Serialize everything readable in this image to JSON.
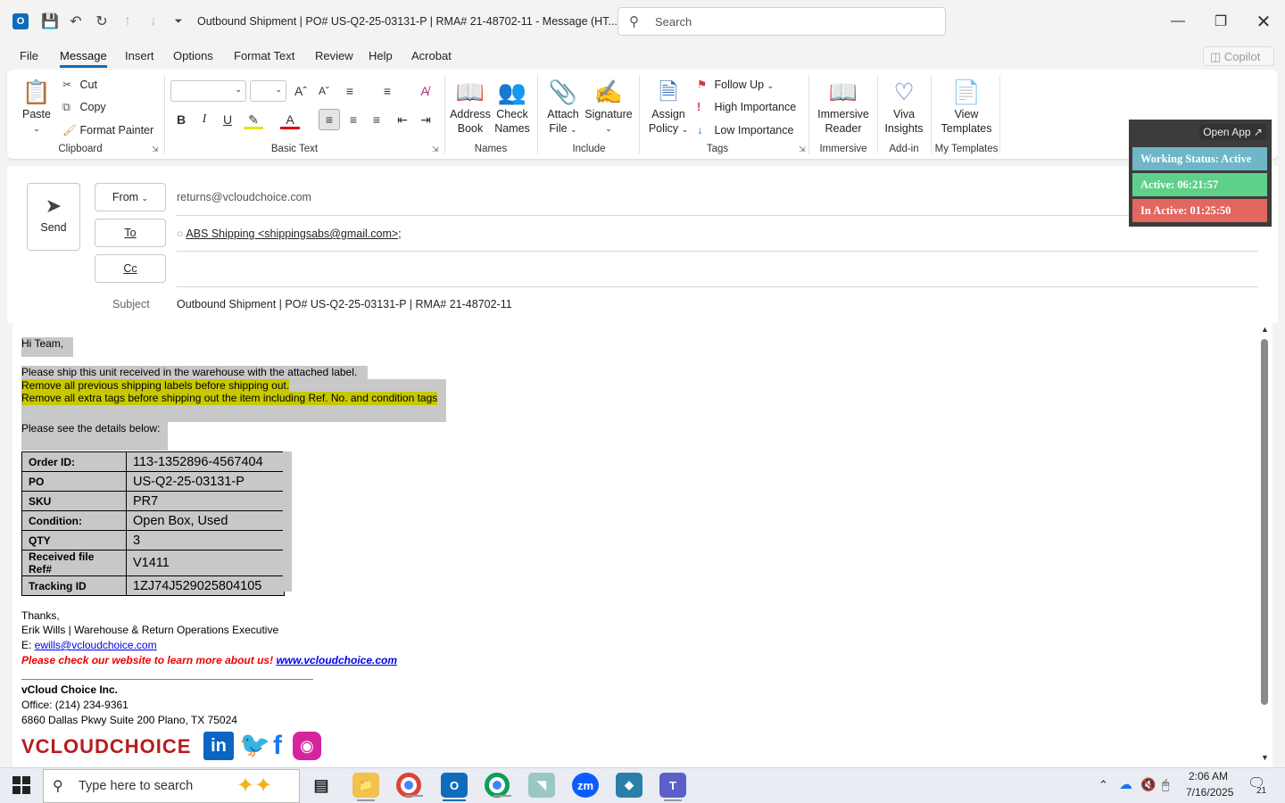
{
  "window": {
    "title": "Outbound Shipment | PO# US-Q2-25-03131-P | RMA# 21-48702-11  -  Message (HT...",
    "search_placeholder": "Search"
  },
  "menu": {
    "tabs": [
      "File",
      "Message",
      "Insert",
      "Options",
      "Format Text",
      "Review",
      "Help",
      "Acrobat"
    ],
    "copilot": "Copilot"
  },
  "ribbon": {
    "clipboard": {
      "paste": "Paste",
      "cut": "Cut",
      "copy": "Copy",
      "format_painter": "Format Painter",
      "label": "Clipboard"
    },
    "basic_text": {
      "label": "Basic Text"
    },
    "names": {
      "address_book_1": "Address",
      "address_book_2": "Book",
      "check_names_1": "Check",
      "check_names_2": "Names",
      "label": "Names"
    },
    "include": {
      "attach_1": "Attach",
      "attach_2": "File",
      "signature": "Signature",
      "label": "Include"
    },
    "tags": {
      "assign_1": "Assign",
      "assign_2": "Policy",
      "follow_up": "Follow Up",
      "high": "High Importance",
      "low": "Low Importance",
      "label": "Tags"
    },
    "immersive": {
      "btn_1": "Immersive",
      "btn_2": "Reader",
      "label": "Immersive"
    },
    "addin": {
      "btn_1": "Viva",
      "btn_2": "Insights",
      "label": "Add-in"
    },
    "templates": {
      "btn_1": "View",
      "btn_2": "Templates",
      "label": "My Templates"
    }
  },
  "compose": {
    "send_label": "Send",
    "from_label": "From",
    "from_value": "returns@vcloudchoice.com",
    "to_label": "To",
    "to_value": "ABS Shipping <shippingsabs@gmail.com>;",
    "cc_label": "Cc",
    "subject_label": "Subject",
    "subject_value": "Outbound Shipment | PO# US-Q2-25-03131-P | RMA# 21-48702-11"
  },
  "status_widget": {
    "open_app": "Open App ↗",
    "working": "Working Status: Active",
    "active": "Active: 06:21:57",
    "inactive": "In Active: 01:25:50",
    "colors": {
      "working": "#6fb6c8",
      "active": "#5fd08a",
      "inactive": "#e2675f"
    }
  },
  "email": {
    "greeting": "Hi Team,",
    "line1": "Please ship this unit received in the warehouse with the attached label.",
    "line2": "Remove all previous shipping labels before shipping out.",
    "line3": "Remove all extra tags before shipping out the item including Ref. No. and condition tags",
    "line4": "Please see the details below:",
    "details": [
      {
        "key": "Order ID:",
        "value": "113-1352896-4567404"
      },
      {
        "key": "PO",
        "value": "US-Q2-25-03131-P"
      },
      {
        "key": "SKU",
        "value": "PR7"
      },
      {
        "key": "Condition:",
        "value": "Open Box, Used"
      },
      {
        "key": "QTY",
        "value": "3"
      },
      {
        "key": "Received file Ref#",
        "value": "V1411"
      },
      {
        "key": "Tracking ID",
        "value": "1ZJ74J529025804105"
      }
    ],
    "thanks": "Thanks,",
    "sig_name": "Erik Wills | Warehouse & Return Operations Executive",
    "sig_email_prefix": "E: ",
    "sig_email": "ewills@vcloudchoice.com",
    "website_text": "Please check our website to learn more about us!",
    "website_link": "www.vcloudchoice.com",
    "company": "vCloud Choice Inc.",
    "office": "Office: (214) 234-9361",
    "address": "6860 Dallas Pkwy Suite 200 Plano, TX 75024",
    "logo_text": "VCLOUDCHOICE"
  },
  "taskbar": {
    "search_placeholder": "Type here to search",
    "time": "2:06 AM",
    "date": "7/16/2025",
    "notifications": "21"
  }
}
